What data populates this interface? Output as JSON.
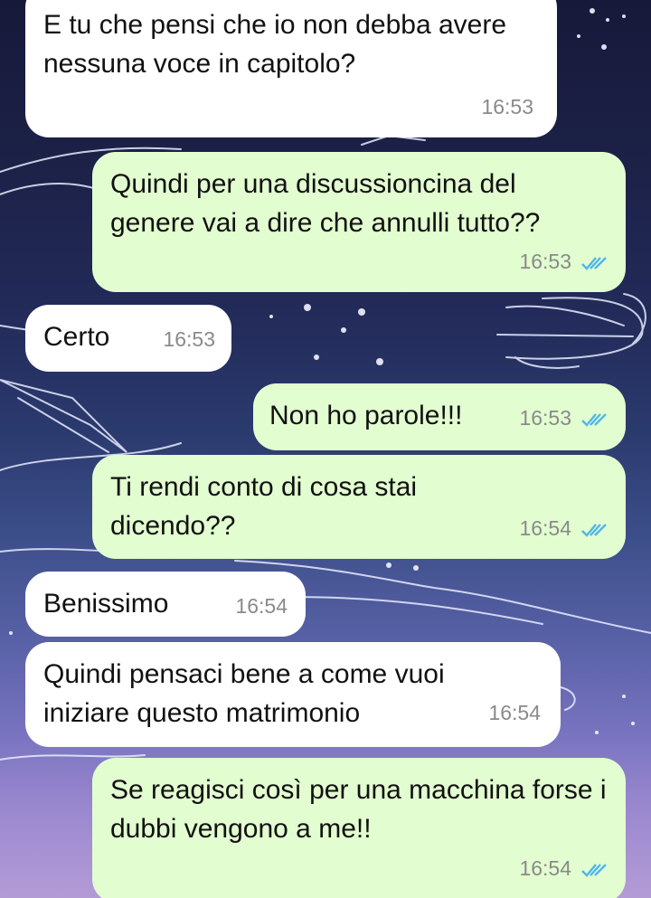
{
  "messages": [
    {
      "id": 1,
      "direction": "incoming",
      "text": "E tu che pensi che io non debba avere nessuna voce in capitolo?",
      "time": "16:53"
    },
    {
      "id": 2,
      "direction": "outgoing",
      "text": "Quindi per una discussioncina del genere vai a dire che annulli tutto??",
      "time": "16:53",
      "status": "read"
    },
    {
      "id": 3,
      "direction": "incoming",
      "text": "Certo",
      "time": "16:53"
    },
    {
      "id": 4,
      "direction": "outgoing",
      "text": "Non ho parole!!!",
      "time": "16:53",
      "status": "read"
    },
    {
      "id": 5,
      "direction": "outgoing",
      "text": "Ti rendi conto di cosa stai dicendo??",
      "time": "16:54",
      "status": "read"
    },
    {
      "id": 6,
      "direction": "incoming",
      "text": "Benissimo",
      "time": "16:54"
    },
    {
      "id": 7,
      "direction": "incoming",
      "text": "Quindi pensaci bene a come vuoi iniziare questo matrimonio",
      "time": "16:54"
    },
    {
      "id": 8,
      "direction": "outgoing",
      "text": "Se reagisci così per una macchina forse i dubbi vengono a me!!",
      "time": "16:54",
      "status": "read"
    }
  ],
  "colors": {
    "incoming_bubble": "#ffffff",
    "outgoing_bubble": "#e2fdd0",
    "read_ticks": "#4fb6ec",
    "timestamp": "#8a8a8a"
  },
  "icons": {
    "read_receipt": "double-check-icon"
  }
}
